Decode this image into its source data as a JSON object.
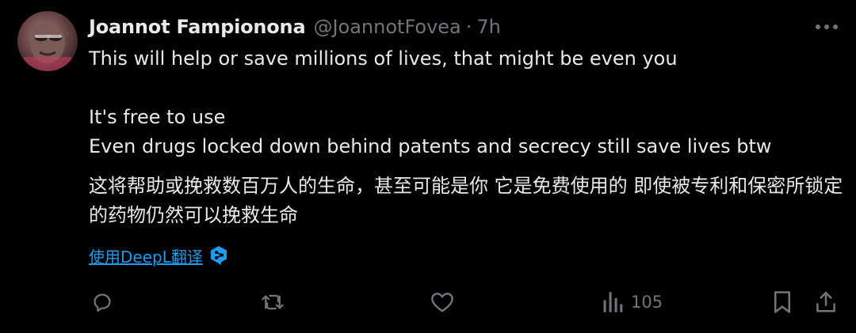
{
  "tweet": {
    "display_name": "Joannot Fampionona",
    "handle": "@JoannotFovea",
    "separator": "·",
    "time": "7h",
    "text": "This will help or save millions of lives, that might be even you\n\nIt's free to use\nEven drugs locked down behind patents and secrecy still save lives btw",
    "translation": "这将帮助或挽救数百万人的生命，甚至可能是你 它是免费使用的 即使被专利和保密所锁定的药物仍然可以挽救生命",
    "translate_label": "使用DeepL翻译",
    "views": "105"
  },
  "icons": {
    "more": "more-horizontal-icon",
    "reply": "reply-icon",
    "retweet": "retweet-icon",
    "like": "heart-icon",
    "views": "bar-chart-icon",
    "bookmark": "bookmark-icon",
    "share": "share-icon",
    "deepl": "deepl-icon"
  },
  "colors": {
    "background": "#000000",
    "text_primary": "#e7e9ea",
    "text_secondary": "#71767b",
    "link": "#1d9bf0"
  }
}
